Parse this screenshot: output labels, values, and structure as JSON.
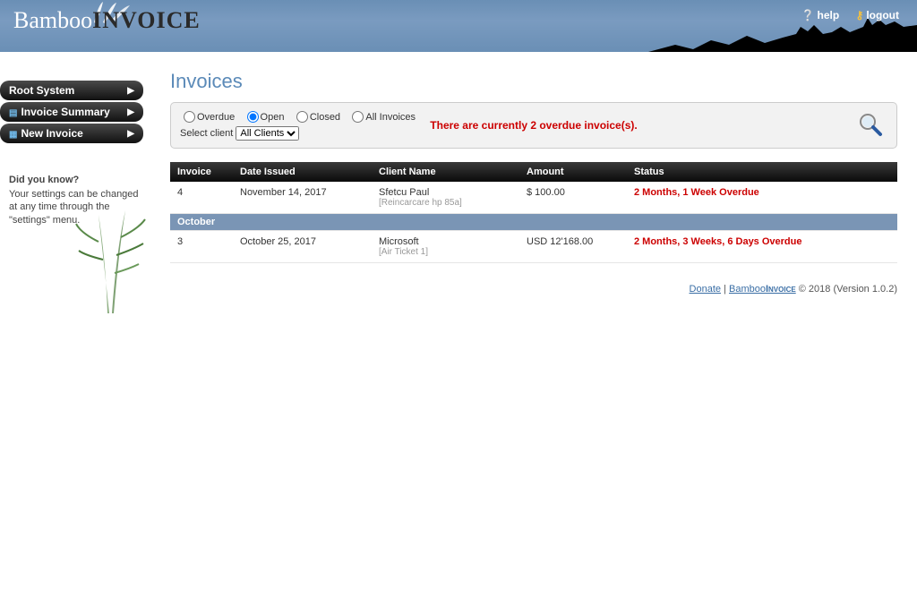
{
  "header": {
    "logo_part1": "Bamboo",
    "logo_part2": "INVOICE",
    "help_label": "help",
    "logout_label": "logout"
  },
  "sidebar": {
    "items": [
      {
        "label": "Root System",
        "icon": ""
      },
      {
        "label": "Invoice Summary",
        "icon": "▪"
      },
      {
        "label": "New Invoice",
        "icon": "▪"
      }
    ],
    "tip_title": "Did you know?",
    "tip_body": "Your settings can be changed at any time through the \"settings\" menu."
  },
  "page": {
    "title": "Invoices",
    "filters": {
      "overdue": "Overdue",
      "open": "Open",
      "closed": "Closed",
      "all": "All Invoices",
      "selected": "open",
      "select_client_label": "Select client",
      "client_value": "All Clients"
    },
    "alert": "There are currently 2 overdue invoice(s).",
    "columns": {
      "invoice": "Invoice",
      "date": "Date Issued",
      "client": "Client Name",
      "amount": "Amount",
      "status": "Status"
    },
    "rows": [
      {
        "invoice": "4",
        "date": "November 14, 2017",
        "client": "Sfetcu Paul",
        "client_sub": "[Reincarcare hp 85a]",
        "amount": "$ 100.00",
        "status": "2 Months, 1 Week Overdue"
      }
    ],
    "month_break": "October",
    "rows2": [
      {
        "invoice": "3",
        "date": "October 25, 2017",
        "client": "Microsoft",
        "client_sub": "[Air Ticket 1]",
        "amount": "USD 12'168.00",
        "status": "2 Months, 3 Weeks, 6 Days Overdue"
      }
    ]
  },
  "footer": {
    "donate": "Donate",
    "sep": " | ",
    "brand1": "Bamboo",
    "brand2": "Invoice",
    "copyright": " © 2018 (Version 1.0.2)"
  }
}
